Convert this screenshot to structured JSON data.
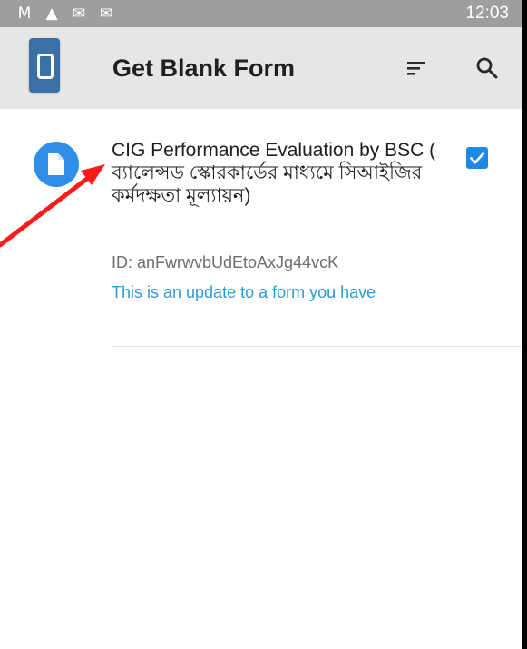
{
  "status_bar": {
    "icons": [
      "gmail-icon",
      "warning-icon",
      "mail-icon",
      "mail-icon"
    ],
    "icon_glyphs": [
      "M",
      "▲",
      "✉",
      "✉"
    ],
    "time": "12:03"
  },
  "app_bar": {
    "title": "Get Blank Form",
    "logo_icon": "odk-collect-logo",
    "actions": [
      "sort-icon",
      "search-icon"
    ]
  },
  "forms": [
    {
      "icon": "document-icon",
      "title": "CIG Performance Evaluation by BSC ( ব্যালেন্সড স্কোরকার্ডের মাধ্যমে সিআইজির কর্মদক্ষতা মূল্যায়ন)",
      "id_text": "ID: anFwrwvbUdEtoAxJg44vcK",
      "update_text": "This is an update to a form you have",
      "checked": true
    }
  ],
  "colors": {
    "status_bar": "#9e9e9e",
    "app_bar": "#e6e6e6",
    "logo": "#3a6fa8",
    "accent": "#1e88e5",
    "form_icon": "#2f8fe6",
    "update_text": "#2f9ad6",
    "annotation": "#ff0000"
  }
}
